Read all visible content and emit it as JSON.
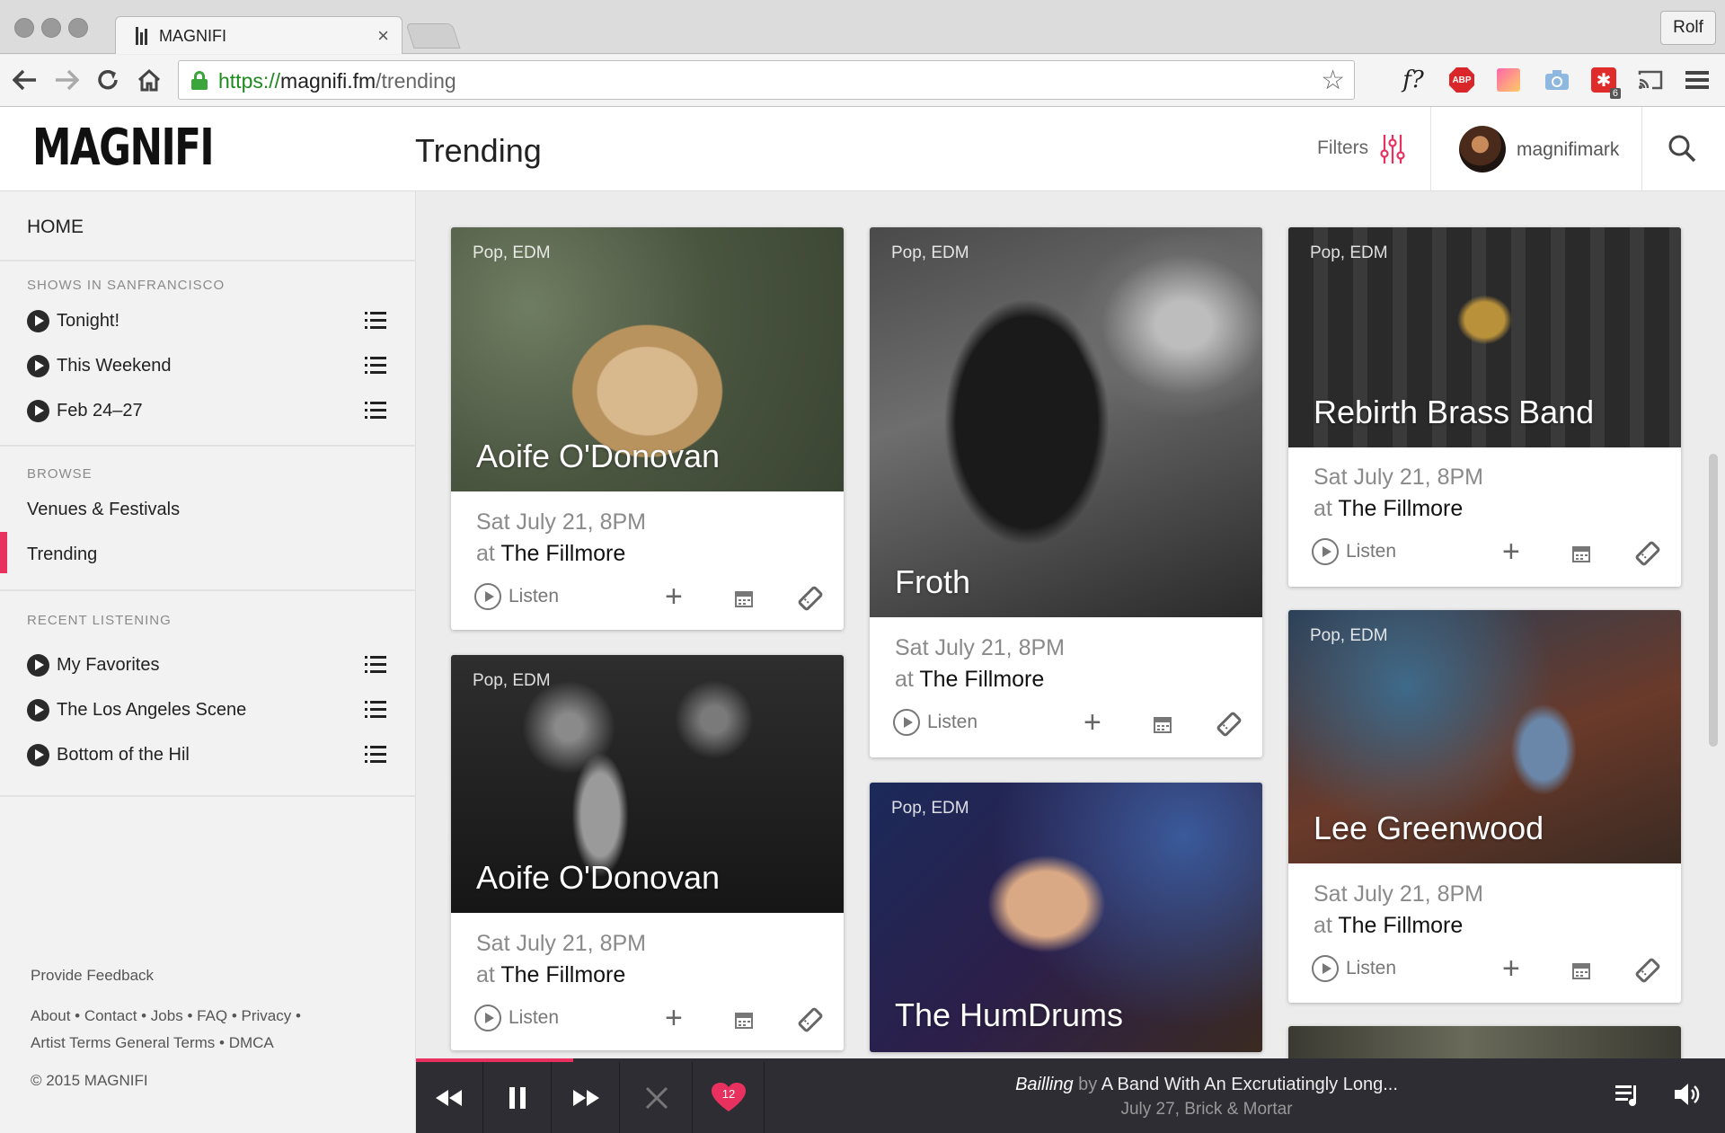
{
  "browser": {
    "tab_title": "MAGNIFI",
    "tab_close": "×",
    "profile": "Rolf",
    "url_protocol": "https://",
    "url_host": "magnifi.fm",
    "url_path": "/trending",
    "ext_abp": "ABP",
    "ext_badge": "6",
    "ext_fquery": "f?"
  },
  "header": {
    "logo": "MAGNIFI",
    "title": "Trending",
    "filters_label": "Filters",
    "username": "magnifimark",
    "accent": "#e8315f"
  },
  "sidebar": {
    "home": "HOME",
    "shows_heading": "SHOWS IN SANFRANCISCO",
    "shows": [
      "Tonight!",
      "This Weekend",
      "Feb 24–27"
    ],
    "browse_heading": "BROWSE",
    "browse": [
      "Venues & Festivals",
      "Trending"
    ],
    "recent_heading": "RECENT LISTENING",
    "recent": [
      "My Favorites",
      "The Los Angeles Scene",
      "Bottom of the Hil"
    ],
    "feedback": "Provide Feedback",
    "links1": "About • Contact • Jobs • FAQ • Privacy •",
    "links2": "Artist Terms General Terms • DMCA",
    "copyright": "© 2015 MAGNIFI"
  },
  "cards": [
    {
      "genre": "Pop, EDM",
      "name": "Aoife O'Donovan",
      "date": "Sat July 21, 8PM",
      "at": "at",
      "venue": "The Fillmore",
      "listen": "Listen"
    },
    {
      "genre": "Pop, EDM",
      "name": "Aoife O'Donovan",
      "date": "Sat July 21, 8PM",
      "at": "at",
      "venue": "The Fillmore",
      "listen": "Listen"
    },
    {
      "genre": "Pop, EDM",
      "name": "Froth",
      "date": "Sat July 21, 8PM",
      "at": "at",
      "venue": "The Fillmore",
      "listen": "Listen"
    },
    {
      "genre": "Pop, EDM",
      "name": "The HumDrums"
    },
    {
      "genre": "Pop, EDM",
      "name": "Rebirth Brass Band",
      "date": "Sat July 21, 8PM",
      "at": "at",
      "venue": "The Fillmore",
      "listen": "Listen"
    },
    {
      "genre": "Pop, EDM",
      "name": "Lee Greenwood",
      "date": "Sat July 21, 8PM",
      "at": "at",
      "venue": "The Fillmore",
      "listen": "Listen"
    }
  ],
  "player": {
    "song": "Bailling",
    "by": "by",
    "artist": "A Band With An Excrutiatingly Long...",
    "event": "July 27, Brick & Mortar",
    "favorites_count": "12",
    "progress_fraction": 0.12
  }
}
